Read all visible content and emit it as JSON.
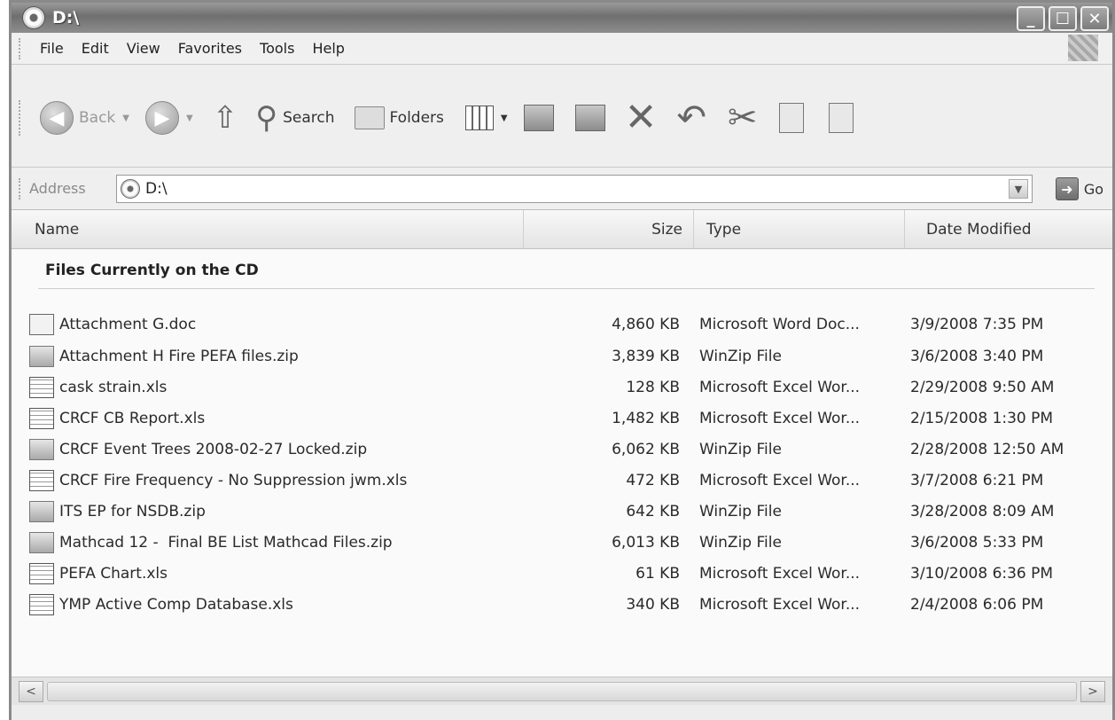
{
  "window": {
    "title": "D:\\",
    "controls": [
      "minimize",
      "maximize",
      "close"
    ]
  },
  "menu": [
    "File",
    "Edit",
    "View",
    "Favorites",
    "Tools",
    "Help"
  ],
  "toolbar": {
    "back_label": "Back",
    "search_label": "Search",
    "folders_label": "Folders"
  },
  "address": {
    "label": "Address",
    "value": "D:\\",
    "go_label": "Go"
  },
  "columns": {
    "name": "Name",
    "size": "Size",
    "type": "Type",
    "date": "Date Modified"
  },
  "group": {
    "label": "Files Currently on the CD"
  },
  "files": [
    {
      "icon": "doc",
      "name": "Attachment G.doc",
      "size": "4,860 KB",
      "type": "Microsoft Word Doc...",
      "date": "3/9/2008 7:35 PM"
    },
    {
      "icon": "zip",
      "name": "Attachment H Fire PEFA files.zip",
      "size": "3,839 KB",
      "type": "WinZip File",
      "date": "3/6/2008 3:40 PM"
    },
    {
      "icon": "xls",
      "name": "cask strain.xls",
      "size": "128 KB",
      "type": "Microsoft Excel Wor...",
      "date": "2/29/2008 9:50 AM"
    },
    {
      "icon": "xls",
      "name": "CRCF CB Report.xls",
      "size": "1,482 KB",
      "type": "Microsoft Excel Wor...",
      "date": "2/15/2008 1:30 PM"
    },
    {
      "icon": "zip",
      "name": "CRCF Event Trees 2008-02-27 Locked.zip",
      "size": "6,062 KB",
      "type": "WinZip File",
      "date": "2/28/2008 12:50 AM"
    },
    {
      "icon": "xls",
      "name": "CRCF Fire Frequency - No Suppression jwm.xls",
      "size": "472 KB",
      "type": "Microsoft Excel Wor...",
      "date": "3/7/2008 6:21 PM"
    },
    {
      "icon": "zip",
      "name": "ITS EP for NSDB.zip",
      "size": "642 KB",
      "type": "WinZip File",
      "date": "3/28/2008 8:09 AM"
    },
    {
      "icon": "zip",
      "name": "Mathcad 12 -  Final BE List Mathcad Files.zip",
      "size": "6,013 KB",
      "type": "WinZip File",
      "date": "3/6/2008 5:33 PM"
    },
    {
      "icon": "xls",
      "name": "PEFA Chart.xls",
      "size": "61 KB",
      "type": "Microsoft Excel Wor...",
      "date": "3/10/2008 6:36 PM"
    },
    {
      "icon": "xls",
      "name": "YMP Active Comp Database.xls",
      "size": "340 KB",
      "type": "Microsoft Excel Wor...",
      "date": "2/4/2008 6:06 PM"
    }
  ]
}
